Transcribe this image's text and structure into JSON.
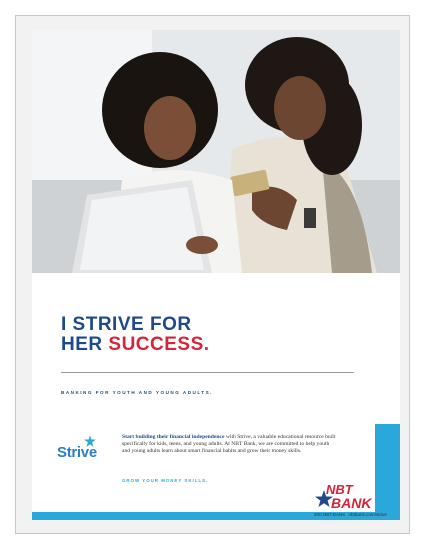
{
  "headline": {
    "line1": "I STRIVE FOR",
    "line2_prefix": "HER ",
    "line2_accent": "SUCCESS."
  },
  "tagline": "BANKING FOR YOUTH AND YOUNG ADULTS.",
  "strive_logo": "Strive",
  "body": {
    "lead": "Start building their financial independence",
    "text": " with Strive, a valuable educational resource built specifically for kids, teens, and young adults. At NBT Bank, we are committed to help youth and young adults learn about smart financial habits and grow their money skills."
  },
  "cta": "GROW YOUR MONEY SKILLS.",
  "bank_logo": {
    "line1": "NBT",
    "line2": "BANK"
  },
  "contact": {
    "phone": "800.NBT.BANK",
    "url": "nbtbank.com/strive"
  },
  "colors": {
    "brand_blue": "#1e4a8c",
    "accent_red": "#d6243b",
    "band_blue": "#2aa8dc"
  },
  "icons": [
    "photo-two-women-laptop",
    "strive-star-icon",
    "nbt-star-icon"
  ]
}
